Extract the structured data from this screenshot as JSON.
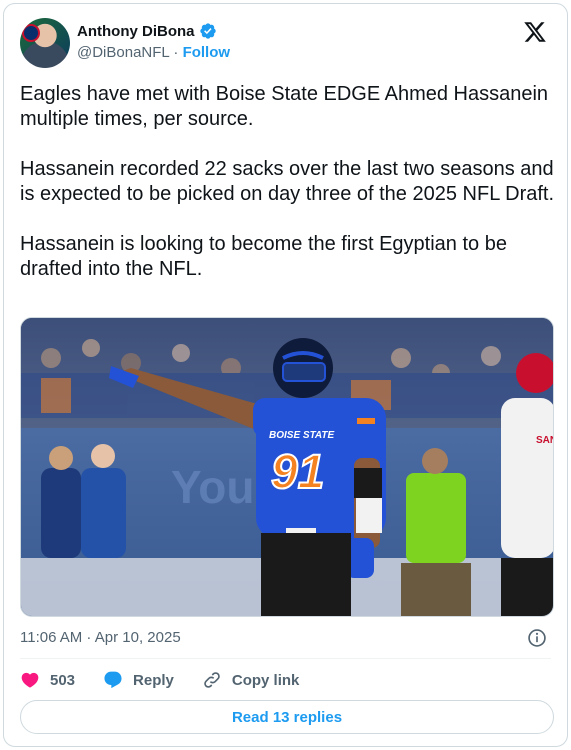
{
  "author": {
    "name": "Anthony DiBona",
    "handle": "@DiBonaNFL",
    "separator": "·",
    "follow_label": "Follow"
  },
  "tweet": {
    "text": "Eagles have met with Boise State EDGE Ahmed Hassanein multiple times, per source.\n\nHassanein recorded 22 sacks over the last two seasons and is expected to be picked on day three of the 2025 NFL Draft.\n\nHassanein is looking to become the first Egyptian to be drafted into the NFL.",
    "timestamp": "11:06 AM · Apr 10, 2025"
  },
  "media": {
    "jersey_text": "BOISE STATE",
    "jersey_number": "91",
    "banner_text": "Your",
    "opponent_jersey_text": "SAN"
  },
  "actions": {
    "likes": "503",
    "reply_label": "Reply",
    "copy_link_label": "Copy link",
    "read_replies_label": "Read 13 replies"
  },
  "colors": {
    "accent": "#1d9bf0",
    "like": "#f91880",
    "muted": "#536471"
  },
  "icons": [
    "verified-icon",
    "x-logo-icon",
    "info-icon",
    "heart-icon",
    "reply-icon",
    "link-icon"
  ]
}
